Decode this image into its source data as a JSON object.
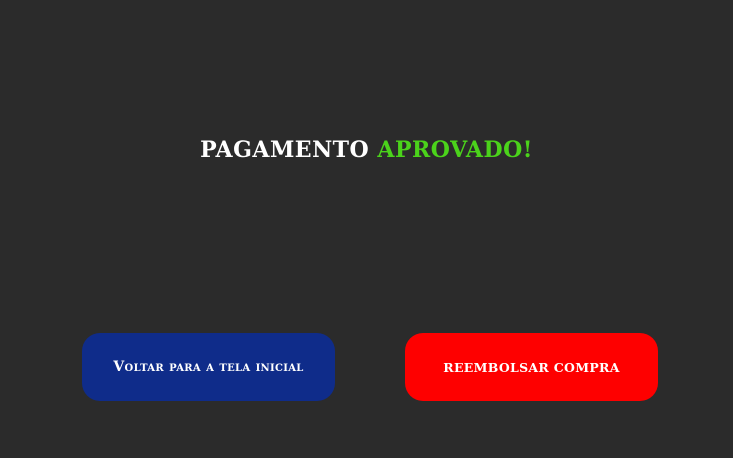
{
  "title": {
    "prefix": "PAGAMENTO",
    "status": "APROVADO!"
  },
  "buttons": {
    "back_label": "Voltar para a tela inicial",
    "refund_label": "REEMBOLSAR COMPRA"
  },
  "colors": {
    "background": "#2b2b2b",
    "title_white": "#ffffff",
    "title_green": "#4bd31b",
    "back_button": "#0f2c8a",
    "refund_button": "#fe0000"
  }
}
